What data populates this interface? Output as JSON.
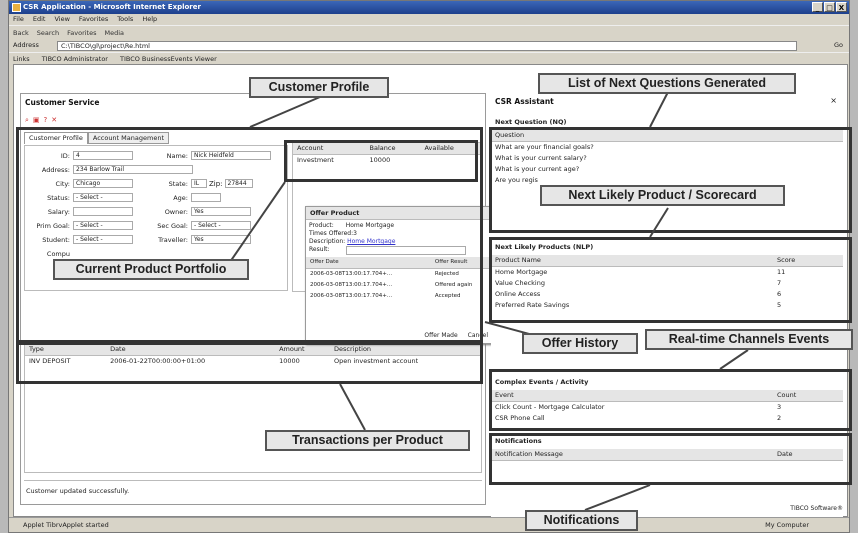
{
  "window": {
    "title": "CSR Application - Microsoft Internet Explorer",
    "min": "_",
    "max": "□",
    "close": "X"
  },
  "menu": [
    "File",
    "Edit",
    "View",
    "Favorites",
    "Tools",
    "Help"
  ],
  "toolbar": [
    "Back",
    "Search",
    "Favorites",
    "Media"
  ],
  "address": {
    "label": "Address",
    "value": "C:\\TIBCO\\gl\\project\\Re.html",
    "go": "Go"
  },
  "links": {
    "label": "Links",
    "items": [
      "TIBCO Administrator",
      "TIBCO BusinessEvents Viewer"
    ]
  },
  "customer_service": {
    "title": "Customer Service",
    "tabs": [
      "Customer Profile",
      "Account Management"
    ],
    "fields": [
      {
        "label": "ID:",
        "value": "4"
      },
      {
        "label": "Name:",
        "value": "Nick Heidfeld"
      },
      {
        "label": "Address:",
        "value": "234 Barlow Trail"
      },
      {
        "label": "City:",
        "value": "Chicago"
      },
      {
        "label": "State:",
        "value": "IL"
      },
      {
        "label": "Zip:",
        "value": "27844"
      },
      {
        "label": "Status:",
        "value": "- Select -"
      },
      {
        "label": "Age:",
        "value": ""
      },
      {
        "label": "Salary:",
        "value": ""
      },
      {
        "label": "Owner:",
        "value": "Yes"
      },
      {
        "label": "Prim Goal:",
        "value": "- Select -"
      },
      {
        "label": "Sec Goal:",
        "value": "- Select -"
      },
      {
        "label": "Student:",
        "value": "- Select -"
      },
      {
        "label": "Traveller:",
        "value": "Yes"
      },
      {
        "label": "Compu",
        "value": ""
      }
    ],
    "portfolio": {
      "headers": [
        "Account",
        "Balance",
        "Available"
      ],
      "rows": [
        [
          "Investment",
          "10000",
          ""
        ]
      ]
    },
    "transactions": {
      "headers": [
        "Type",
        "Date",
        "Amount",
        "Description"
      ],
      "rows": [
        [
          "INV DEPOSIT",
          "2006-01-22T00:00:00+01:00",
          "10000",
          "Open investment account"
        ]
      ]
    },
    "status": "Customer updated successfully."
  },
  "offer": {
    "title": "Offer Product",
    "product_label": "Product:",
    "product": "Home Mortgage",
    "times_label": "Times Offered:",
    "times": "3",
    "desc_label": "Description:",
    "desc": "Home Mortgage",
    "result_label": "Result:",
    "headers": [
      "Offer Date",
      "Offer Result"
    ],
    "rows": [
      [
        "2006-03-08T13:00:17.704+...",
        "Rejected"
      ],
      [
        "2006-03-08T13:00:17.704+...",
        "Offered again"
      ],
      [
        "2006-03-08T13:00:17.704+...",
        "Accepted"
      ]
    ],
    "btn_made": "Offer Made",
    "btn_cancel": "Cancel"
  },
  "csr": {
    "title": "CSR Assistant",
    "close": "×",
    "nq": {
      "title": "Next Question (NQ)",
      "header": "Question",
      "rows": [
        "What are your financial goals?",
        "What is your current salary?",
        "What is your current age?",
        "Are you regis"
      ]
    },
    "nlp": {
      "title": "Next Likely Products (NLP)",
      "headers": [
        "Product Name",
        "Score"
      ],
      "rows": [
        [
          "Home Mortgage",
          "11"
        ],
        [
          "Value Checking",
          "7"
        ],
        [
          "Online Access",
          "6"
        ],
        [
          "Preferred Rate Savings",
          "5"
        ]
      ]
    },
    "ce": {
      "title": "Complex Events / Activity",
      "headers": [
        "Event",
        "Count"
      ],
      "rows": [
        [
          "Click Count - Mortgage Calculator",
          "3"
        ],
        [
          "CSR Phone Call",
          "2"
        ]
      ]
    },
    "notif": {
      "title": "Notifications",
      "headers": [
        "Notification Message",
        "Date"
      ]
    }
  },
  "callouts": {
    "customer_profile": "Customer Profile",
    "next_questions": "List of Next Questions Generated",
    "scorecard": "Next Likely Product / Scorecard",
    "portfolio": "Current Product Portfolio",
    "offer_history": "Offer History",
    "realtime": "Real-time Channels Events",
    "transactions": "Transactions per Product",
    "notifications": "Notifications"
  },
  "footer": {
    "brand": "TIBCO Software®",
    "status": "Applet TibrvApplet started",
    "zone": "My Computer"
  }
}
